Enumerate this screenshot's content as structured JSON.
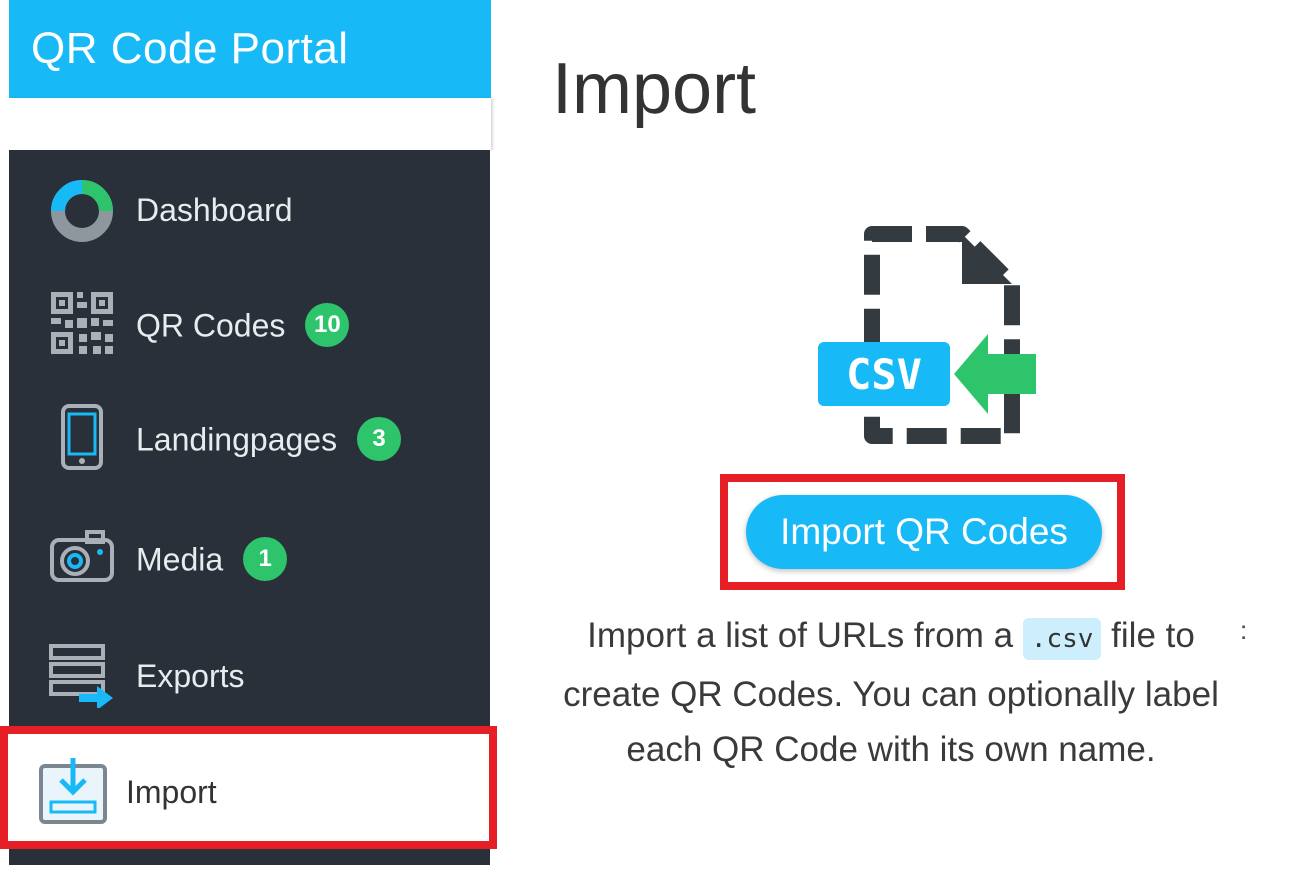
{
  "app": {
    "title": "QR Code Portal"
  },
  "sidebar": {
    "items": [
      {
        "label": "Dashboard",
        "icon": "donut-chart-icon"
      },
      {
        "label": "QR Codes",
        "badge": "10",
        "icon": "qr-code-icon"
      },
      {
        "label": "Landingpages",
        "badge": "3",
        "icon": "mobile-phone-icon"
      },
      {
        "label": "Media",
        "badge": "1",
        "icon": "camera-icon"
      },
      {
        "label": "Exports",
        "icon": "export-stack-icon"
      },
      {
        "label": "Import",
        "icon": "import-tray-icon",
        "active": true
      }
    ]
  },
  "main": {
    "title": "Import",
    "illustration": {
      "file_label": "CSV",
      "icon": "csv-file-import-icon"
    },
    "import_button": "Import QR Codes",
    "description": {
      "before": "Import a list of URLs from a ",
      "code": ".csv",
      "after": " file to create QR Codes. You can optionally label each QR Code with its own name."
    },
    "stray_mark": ":"
  },
  "colors": {
    "accent": "#18b9f7",
    "sidebar_bg": "#293039",
    "badge": "#2ec46c",
    "highlight": "#e61e25"
  }
}
